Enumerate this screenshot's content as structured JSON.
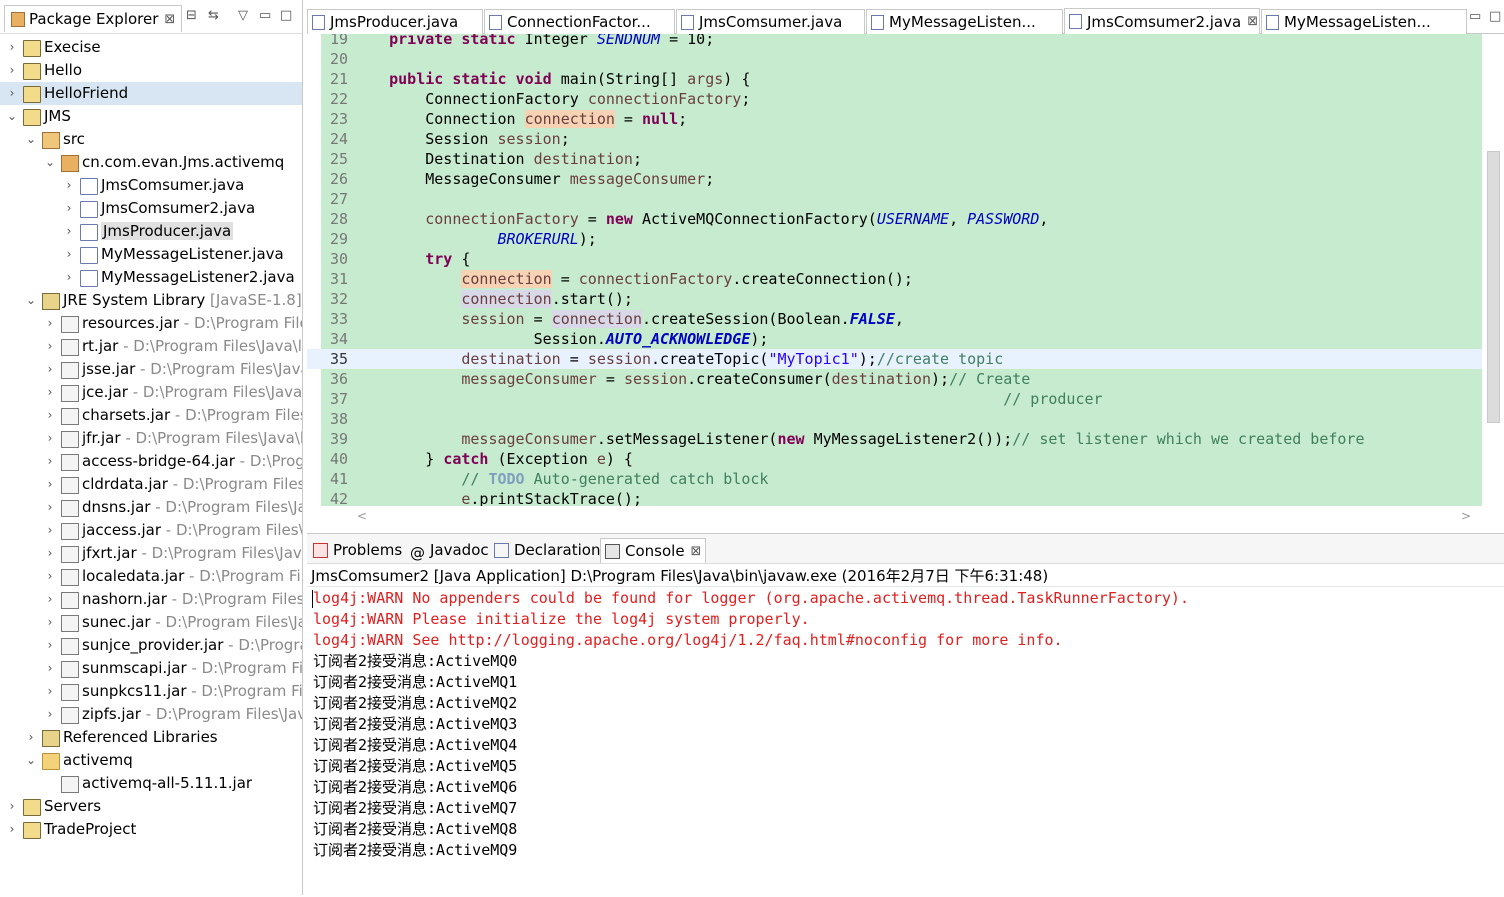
{
  "package_explorer": {
    "title": "Package Explorer",
    "close": "⊠",
    "controls": [
      "⊟",
      "⇆",
      "▽",
      "▭",
      "□"
    ],
    "items": [
      {
        "label": "Execise",
        "sub": "",
        "icon": "project-icon",
        "arrow": "›"
      },
      {
        "label": "Hello",
        "sub": "",
        "icon": "project-icon",
        "arrow": "›"
      },
      {
        "label": "HelloFriend",
        "sub": "",
        "icon": "project-icon",
        "arrow": "›"
      },
      {
        "label": "JMS",
        "sub": "",
        "icon": "project-icon",
        "arrow": "⌄"
      },
      {
        "label": "src",
        "sub": "",
        "icon": "source-folder-icon",
        "arrow": "⌄"
      },
      {
        "label": "cn.com.evan.Jms.activemq",
        "sub": "",
        "icon": "package-icon",
        "arrow": "⌄"
      },
      {
        "label": "JmsComsumer.java",
        "sub": "",
        "icon": "java-file-icon",
        "arrow": "›"
      },
      {
        "label": "JmsComsumer2.java",
        "sub": "",
        "icon": "java-file-icon",
        "arrow": "›"
      },
      {
        "label": "JmsProducer.java",
        "sub": "",
        "icon": "java-file-icon",
        "arrow": "›"
      },
      {
        "label": "MyMessageListener.java",
        "sub": "",
        "icon": "java-file-icon",
        "arrow": "›"
      },
      {
        "label": "MyMessageListener2.java",
        "sub": "",
        "icon": "java-file-icon",
        "arrow": "›"
      },
      {
        "label": "JRE System Library",
        "sub": " [JavaSE-1.8]",
        "icon": "library-icon",
        "arrow": "⌄"
      },
      {
        "label": "resources.jar",
        "sub": " - D:\\Program File",
        "icon": "jar-icon",
        "arrow": "›"
      },
      {
        "label": "rt.jar",
        "sub": " - D:\\Program Files\\Java\\li",
        "icon": "jar-icon",
        "arrow": "›"
      },
      {
        "label": "jsse.jar",
        "sub": " - D:\\Program Files\\Java",
        "icon": "jar-icon",
        "arrow": "›"
      },
      {
        "label": "jce.jar",
        "sub": " - D:\\Program Files\\Java\\",
        "icon": "jar-icon",
        "arrow": "›"
      },
      {
        "label": "charsets.jar",
        "sub": " - D:\\Program Files\\",
        "icon": "jar-icon",
        "arrow": "›"
      },
      {
        "label": "jfr.jar",
        "sub": " - D:\\Program Files\\Java\\l",
        "icon": "jar-icon",
        "arrow": "›"
      },
      {
        "label": "access-bridge-64.jar",
        "sub": " - D:\\Prog",
        "icon": "jar-icon",
        "arrow": "›"
      },
      {
        "label": "cldrdata.jar",
        "sub": " - D:\\Program Files\\",
        "icon": "jar-icon",
        "arrow": "›"
      },
      {
        "label": "dnsns.jar",
        "sub": " - D:\\Program Files\\Ja",
        "icon": "jar-icon",
        "arrow": "›"
      },
      {
        "label": "jaccess.jar",
        "sub": " - D:\\Program Files\\Ja",
        "icon": "jar-icon",
        "arrow": "›"
      },
      {
        "label": "jfxrt.jar",
        "sub": " - D:\\Program Files\\Java",
        "icon": "jar-icon",
        "arrow": "›"
      },
      {
        "label": "localedata.jar",
        "sub": " - D:\\Program Fil",
        "icon": "jar-icon",
        "arrow": "›"
      },
      {
        "label": "nashorn.jar",
        "sub": " - D:\\Program Files\\",
        "icon": "jar-icon",
        "arrow": "›"
      },
      {
        "label": "sunec.jar",
        "sub": " - D:\\Program Files\\Ja",
        "icon": "jar-icon",
        "arrow": "›"
      },
      {
        "label": "sunjce_provider.jar",
        "sub": " - D:\\Progra",
        "icon": "jar-icon",
        "arrow": "›"
      },
      {
        "label": "sunmscapi.jar",
        "sub": " - D:\\Program Fil",
        "icon": "jar-icon",
        "arrow": "›"
      },
      {
        "label": "sunpkcs11.jar",
        "sub": " - D:\\Program Fil",
        "icon": "jar-icon",
        "arrow": "›"
      },
      {
        "label": "zipfs.jar",
        "sub": " - D:\\Program Files\\Jav",
        "icon": "jar-icon",
        "arrow": "›"
      },
      {
        "label": "Referenced Libraries",
        "sub": "",
        "icon": "library-icon",
        "arrow": "›"
      },
      {
        "label": "activemq",
        "sub": "",
        "icon": "folder-icon",
        "arrow": "⌄"
      },
      {
        "label": "activemq-all-5.11.1.jar",
        "sub": "",
        "icon": "jar-icon",
        "arrow": ""
      },
      {
        "label": "Servers",
        "sub": "",
        "icon": "project-icon",
        "arrow": "›"
      },
      {
        "label": "TradeProject",
        "sub": "",
        "icon": "project-icon",
        "arrow": "›"
      }
    ]
  },
  "editor": {
    "tabs": [
      {
        "label": "JmsProducer.java",
        "close": ""
      },
      {
        "label": "ConnectionFactor...",
        "close": ""
      },
      {
        "label": "JmsComsumer.java",
        "close": ""
      },
      {
        "label": "MyMessageListen...",
        "close": ""
      },
      {
        "label": "JmsComsumer2.java",
        "close": "⊠"
      },
      {
        "label": "MyMessageListen...",
        "close": ""
      }
    ],
    "window_controls": [
      "▭",
      "□"
    ],
    "line_numbers": [
      "19",
      "20",
      "21",
      "22",
      "23",
      "24",
      "25",
      "26",
      "27",
      "28",
      "29",
      "30",
      "31",
      "32",
      "33",
      "34",
      "35",
      "36",
      "37",
      "38",
      "39",
      "40",
      "41",
      "42"
    ],
    "scroll_left": "<",
    "scroll_right": ">"
  },
  "console": {
    "tabs": [
      {
        "label": "Problems",
        "close": ""
      },
      {
        "label": "Javadoc",
        "close": ""
      },
      {
        "label": "Declaration",
        "close": ""
      },
      {
        "label": "Console",
        "close": "⊠"
      }
    ],
    "description": "JmsComsumer2 [Java Application] D:\\Program Files\\Java\\bin\\javaw.exe (2016年2月7日 下午6:31:48)",
    "lines": [
      {
        "text": "log4j:WARN No appenders could be found for logger (org.apache.activemq.thread.TaskRunnerFactory).",
        "err": true
      },
      {
        "text": "log4j:WARN Please initialize the log4j system properly.",
        "err": true
      },
      {
        "text": "log4j:WARN See http://logging.apache.org/log4j/1.2/faq.html#noconfig for more info.",
        "err": true
      },
      {
        "text": "订阅者2接受消息:ActiveMQ0",
        "err": false
      },
      {
        "text": "订阅者2接受消息:ActiveMQ1",
        "err": false
      },
      {
        "text": "订阅者2接受消息:ActiveMQ2",
        "err": false
      },
      {
        "text": "订阅者2接受消息:ActiveMQ3",
        "err": false
      },
      {
        "text": "订阅者2接受消息:ActiveMQ4",
        "err": false
      },
      {
        "text": "订阅者2接受消息:ActiveMQ5",
        "err": false
      },
      {
        "text": "订阅者2接受消息:ActiveMQ6",
        "err": false
      },
      {
        "text": "订阅者2接受消息:ActiveMQ7",
        "err": false
      },
      {
        "text": "订阅者2接受消息:ActiveMQ8",
        "err": false
      },
      {
        "text": "订阅者2接受消息:ActiveMQ9",
        "err": false
      }
    ]
  },
  "code": {
    "l19_a": "private",
    "l19_b": "static",
    "l19_c": " Integer ",
    "l19_d": "SENDNUM",
    "l19_e": " = 10;",
    "l21_a": "public",
    "l21_b": "static",
    "l21_c": "void",
    "l21_d": " main(String[] ",
    "l21_e": "args",
    "l21_f": ") {",
    "l22_a": "ConnectionFactory ",
    "l22_b": "connectionFactory",
    "l22_c": ";",
    "l23_a": "Connection ",
    "l23_b": "connection",
    "l23_c": " = ",
    "l23_d": "null",
    "l23_e": ";",
    "l24_a": "Session ",
    "l24_b": "session",
    "l24_c": ";",
    "l25_a": "Destination ",
    "l25_b": "destination",
    "l25_c": ";",
    "l26_a": "MessageConsumer ",
    "l26_b": "messageConsumer",
    "l26_c": ";",
    "l28_a": "connectionFactory",
    "l28_b": " = ",
    "l28_c": "new",
    "l28_d": " ActiveMQConnectionFactory(",
    "l28_e": "USERNAME",
    "l28_f": ", ",
    "l28_g": "PASSWORD",
    "l28_h": ",",
    "l29_a": "BROKERURL",
    "l29_b": ");",
    "l30_a": "try",
    "l30_b": " {",
    "l31_a": "connection",
    "l31_b": " = ",
    "l31_c": "connectionFactory",
    "l31_d": ".createConnection();",
    "l32_a": "connection",
    "l32_b": ".start();",
    "l33_a": "session",
    "l33_b": " = ",
    "l33_c": "connection",
    "l33_d": ".createSession(Boolean.",
    "l33_e": "FALSE",
    "l33_f": ",",
    "l34_a": "Session.",
    "l34_b": "AUTO_ACKNOWLEDGE",
    "l34_c": ");",
    "l35_a": "destination",
    "l35_b": " = ",
    "l35_c": "session",
    "l35_d": ".createTopic(",
    "l35_e": "\"MyTopic1\"",
    "l35_f": ");",
    "l35_g": "//create topic",
    "l36_a": "messageConsumer",
    "l36_b": " = ",
    "l36_c": "session",
    "l36_d": ".createConsumer(",
    "l36_e": "destination",
    "l36_f": ");",
    "l36_g": "// Create",
    "l37_a": "// producer",
    "l39_a": "messageConsumer",
    "l39_b": ".setMessageListener(",
    "l39_c": "new",
    "l39_d": " MyMessageListener2());",
    "l39_e": "// set listener which we created before",
    "l40_a": "} ",
    "l40_b": "catch",
    "l40_c": " (Exception ",
    "l40_d": "e",
    "l40_e": ") {",
    "l41_a": "// ",
    "l41_b": "TODO",
    "l41_c": " Auto-generated catch block",
    "l42_a": "e",
    "l42_b": ".printStackTrace();"
  }
}
